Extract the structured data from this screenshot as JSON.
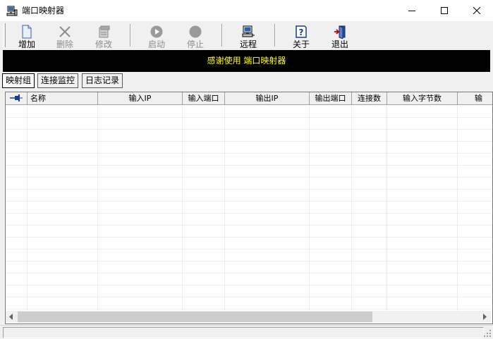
{
  "window": {
    "title": "端口映射器",
    "app_icon": "network-computer-icon",
    "controls": [
      "minimize-icon",
      "maximize-icon",
      "close-icon"
    ]
  },
  "toolbar": {
    "buttons": [
      {
        "label": "增加",
        "icon": "new-document-icon",
        "enabled": true
      },
      {
        "label": "删除",
        "icon": "delete-x-icon",
        "enabled": false
      },
      {
        "label": "修改",
        "icon": "edit-document-icon",
        "enabled": false
      },
      {
        "label": "启动",
        "icon": "play-icon",
        "enabled": false
      },
      {
        "label": "停止",
        "icon": "stop-icon",
        "enabled": false
      },
      {
        "label": "远程",
        "icon": "remote-computer-icon",
        "enabled": true
      },
      {
        "label": "关于",
        "icon": "help-icon",
        "enabled": true
      },
      {
        "label": "退出",
        "icon": "exit-door-icon",
        "enabled": true
      }
    ]
  },
  "banner": {
    "text": "感谢使用 端口映射器",
    "text_color": "#ffff00",
    "background": "#000000"
  },
  "tabs": [
    {
      "label": "映射组",
      "active": true
    },
    {
      "label": "连接监控",
      "active": false
    },
    {
      "label": "日志记录",
      "active": false
    }
  ],
  "grid": {
    "pin_icon": "pin-icon",
    "columns": [
      "名称",
      "输入IP",
      "输入端口",
      "输出IP",
      "输出端口",
      "连接数",
      "输入字节数",
      "输"
    ],
    "rows": []
  },
  "scrollbar": {
    "left_icon": "scroll-left-icon",
    "right_icon": "scroll-right-icon"
  }
}
